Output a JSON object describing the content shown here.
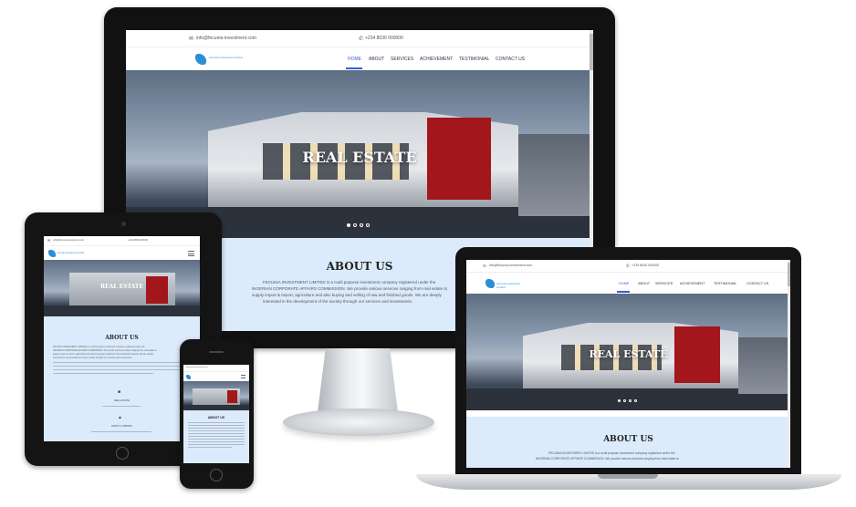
{
  "site": {
    "email": "info@fecunia-investment.com",
    "phone": "+234 8030 000000",
    "brand": "Fecunia Investment Limited",
    "nav": [
      "HOME",
      "ABOUT",
      "SERVICES",
      "ACHIEVEMENT",
      "TESTIMONIAL",
      "CONTACT US"
    ],
    "hero_title": "REAL ESTATE",
    "about_title": "ABOUT US",
    "about_text_1": "FECUNIA INVESTMENT LIMITED is a multi purpose investment company registered under the",
    "about_text_2": "NIGERIAN CORPORATE AFFAIRS COMMISSION. We provide various services ranging from real estate to",
    "about_text_3": "supply import & export, agriculture and also buying and selling of raw and finished goods. We are deeply",
    "about_text_4": "interested in the development of the society through our services and investments.",
    "phone_service_1": "REAL ESTATE",
    "phone_service_2": "SUPPLY & IMPORT"
  },
  "colors": {
    "accent": "#3b5bd9",
    "about_bg": "#dcebfb",
    "device_black": "#141414"
  }
}
